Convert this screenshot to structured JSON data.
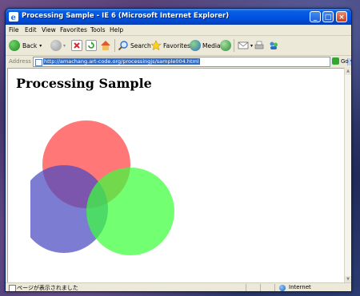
{
  "window": {
    "title": "Processing Sample - IE 6 (Microsoft Internet Explorer)",
    "controls": {
      "minimize": "_",
      "maximize": "□",
      "close": "×"
    }
  },
  "menu": [
    "File",
    "Edit",
    "View",
    "Favorites",
    "Tools",
    "Help"
  ],
  "toolbar": {
    "back_label": "Back",
    "search_label": "Search",
    "favorites_label": "Favorites",
    "media_label": "Media"
  },
  "address": {
    "label": "Address",
    "url": "http://amachang.art-code.org/processingjs/sample004.html",
    "go_label": "Go"
  },
  "page": {
    "heading": "Processing Sample",
    "circles": [
      {
        "color": "#ff4a4a",
        "opacity": 0.75
      },
      {
        "color": "#4a4ac0",
        "opacity": 0.72
      },
      {
        "color": "#3cff3c",
        "opacity": 0.72
      }
    ]
  },
  "status": {
    "text": "ページが表示されました",
    "zone": "Internet"
  }
}
